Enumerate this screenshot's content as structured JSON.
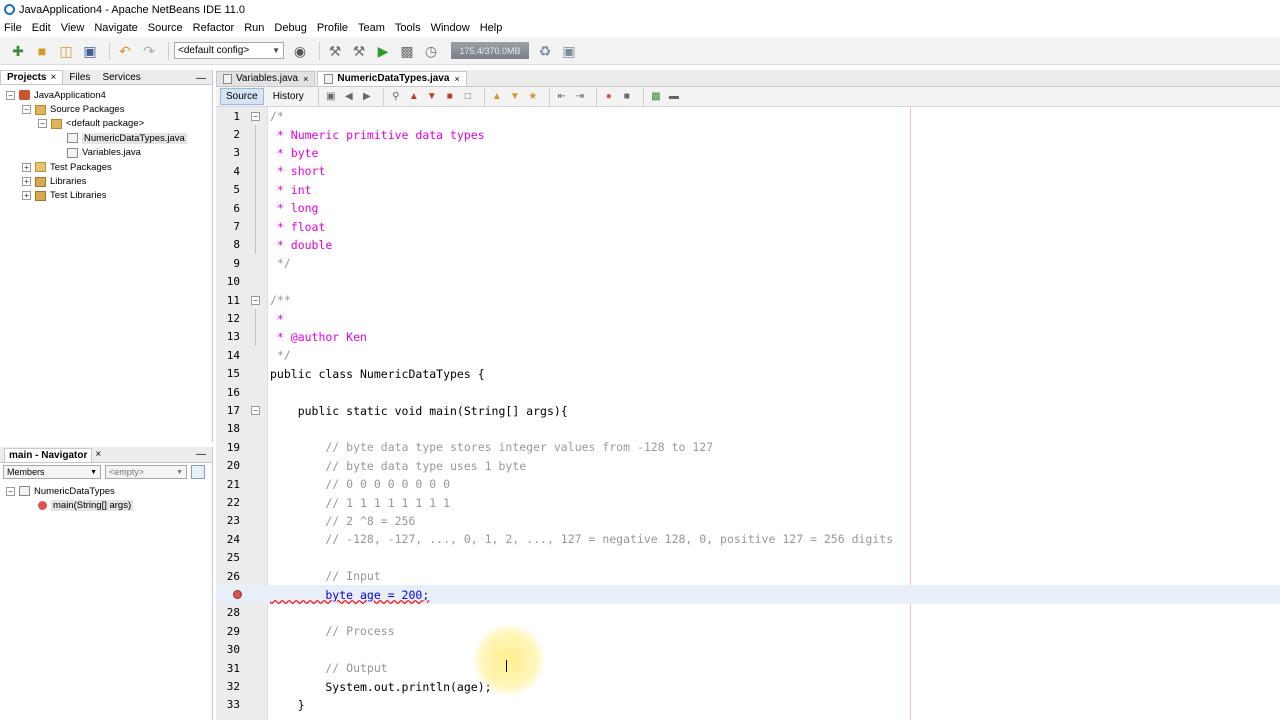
{
  "window": {
    "title": "JavaApplication4 - Apache NetBeans IDE 11.0"
  },
  "menu": [
    "File",
    "Edit",
    "View",
    "Navigate",
    "Source",
    "Refactor",
    "Run",
    "Debug",
    "Profile",
    "Team",
    "Tools",
    "Window",
    "Help"
  ],
  "toolbar": {
    "config": "<default config>",
    "memory": "175.4/370.0MB"
  },
  "projects_panel": {
    "tabs": [
      "Projects",
      "Files",
      "Services"
    ],
    "active_tab": "Projects",
    "tree": [
      {
        "label": "JavaApplication4",
        "level": 0,
        "toggle": "−",
        "icon": "project"
      },
      {
        "label": "Source Packages",
        "level": 1,
        "toggle": "−",
        "icon": "package-folder"
      },
      {
        "label": "<default package>",
        "level": 2,
        "toggle": "−",
        "icon": "package"
      },
      {
        "label": "NumericDataTypes.java",
        "level": 3,
        "toggle": "",
        "icon": "java-file",
        "selected": true
      },
      {
        "label": "Variables.java",
        "level": 3,
        "toggle": "",
        "icon": "java-file"
      },
      {
        "label": "Test Packages",
        "level": 1,
        "toggle": "+",
        "icon": "folder"
      },
      {
        "label": "Libraries",
        "level": 1,
        "toggle": "+",
        "icon": "library"
      },
      {
        "label": "Test Libraries",
        "level": 1,
        "toggle": "+",
        "icon": "library"
      }
    ]
  },
  "navigator": {
    "title": "main - Navigator",
    "filter": "Members",
    "secondary": "<empty>",
    "items": [
      {
        "label": "NumericDataTypes",
        "level": 0
      },
      {
        "label": "main(String[] args)",
        "level": 1
      }
    ]
  },
  "editor": {
    "tabs": [
      {
        "label": "Variables.java",
        "active": false
      },
      {
        "label": "NumericDataTypes.java",
        "active": true
      }
    ],
    "modes": [
      "Source",
      "History"
    ],
    "active_mode": "Source",
    "lines": [
      {
        "n": "1",
        "text": "/*"
      },
      {
        "n": "2",
        "text": " * Numeric primitive data types"
      },
      {
        "n": "3",
        "text": " * byte"
      },
      {
        "n": "4",
        "text": " * short"
      },
      {
        "n": "5",
        "text": " * int"
      },
      {
        "n": "6",
        "text": " * long"
      },
      {
        "n": "7",
        "text": " * float"
      },
      {
        "n": "8",
        "text": " * double"
      },
      {
        "n": "9",
        "text": " */"
      },
      {
        "n": "10",
        "text": ""
      },
      {
        "n": "11",
        "text": "/**"
      },
      {
        "n": "12",
        "text": " *"
      },
      {
        "n": "13",
        "text": " * @author Ken"
      },
      {
        "n": "14",
        "text": " */"
      },
      {
        "n": "15",
        "text": "public class NumericDataTypes {"
      },
      {
        "n": "16",
        "text": ""
      },
      {
        "n": "17",
        "text": "    public static void main(String[] args){"
      },
      {
        "n": "18",
        "text": ""
      },
      {
        "n": "19",
        "text": "        // byte data type stores integer values from -128 to 127"
      },
      {
        "n": "20",
        "text": "        // byte data type uses 1 byte"
      },
      {
        "n": "21",
        "text": "        // 0 0 0 0 0 0 0 0"
      },
      {
        "n": "22",
        "text": "        // 1 1 1 1 1 1 1 1"
      },
      {
        "n": "23",
        "text": "        // 2 ^8 = 256"
      },
      {
        "n": "24",
        "text": "        // -128, -127, ..., 0, 1, 2, ..., 127 = negative 128, 0, positive 127 = 256 digits"
      },
      {
        "n": "25",
        "text": ""
      },
      {
        "n": "26",
        "text": "        // Input"
      },
      {
        "n": "27",
        "text": "        byte age = 200;"
      },
      {
        "n": "28",
        "text": ""
      },
      {
        "n": "29",
        "text": "        // Process"
      },
      {
        "n": "30",
        "text": ""
      },
      {
        "n": "31",
        "text": "        // Output"
      },
      {
        "n": "32",
        "text": "        System.out.println(age);"
      },
      {
        "n": "33",
        "text": "    }"
      }
    ]
  }
}
